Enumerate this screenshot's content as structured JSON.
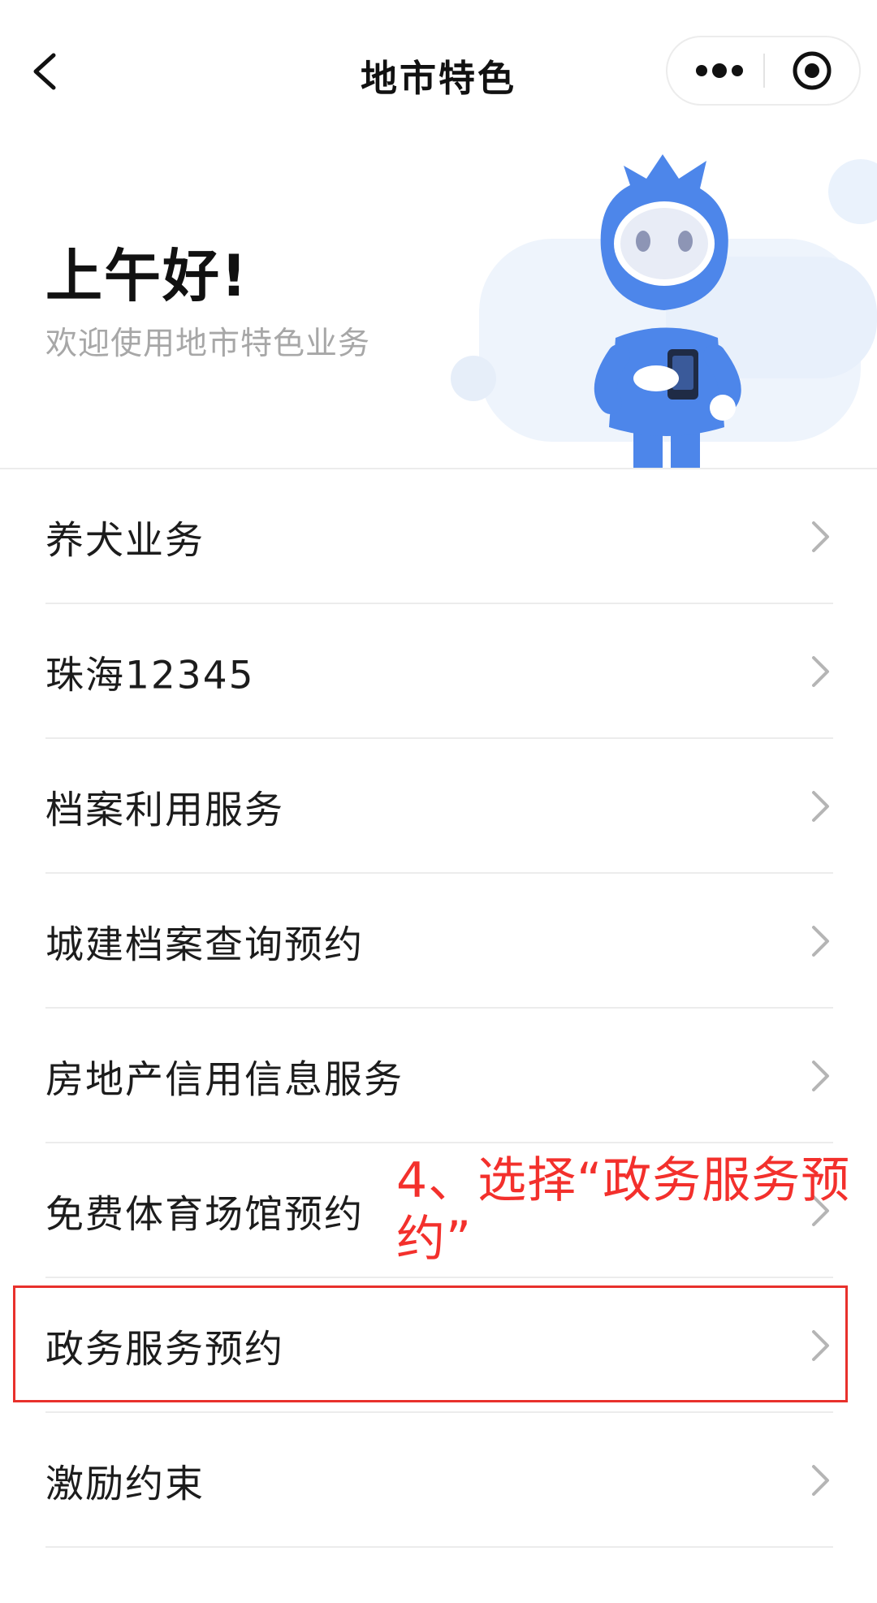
{
  "navbar": {
    "title": "地市特色",
    "back_icon": "chevron-left-icon",
    "more_icon": "more-dots-icon",
    "close_icon": "target-circle-icon"
  },
  "hero": {
    "greeting": "上午好!",
    "subtitle": "欢迎使用地市特色业务",
    "illustration": "blue-robot-mascot"
  },
  "services": [
    {
      "label": "养犬业务"
    },
    {
      "label": "珠海12345"
    },
    {
      "label": "档案利用服务"
    },
    {
      "label": "城建档案查询预约"
    },
    {
      "label": "房地产信用信息服务"
    },
    {
      "label": "免费体育场馆预约"
    },
    {
      "label": "政务服务预约"
    },
    {
      "label": "激励约束"
    }
  ],
  "annotation": {
    "text": "4、选择“政务服务预约”",
    "highlighted_item": "政务服务预约",
    "color": "#f3302c"
  },
  "colors": {
    "accent_blue": "#4f8ff0",
    "annotation_red": "#e8312c",
    "divider": "#ececec",
    "subtitle_gray": "#a7a7a7"
  }
}
